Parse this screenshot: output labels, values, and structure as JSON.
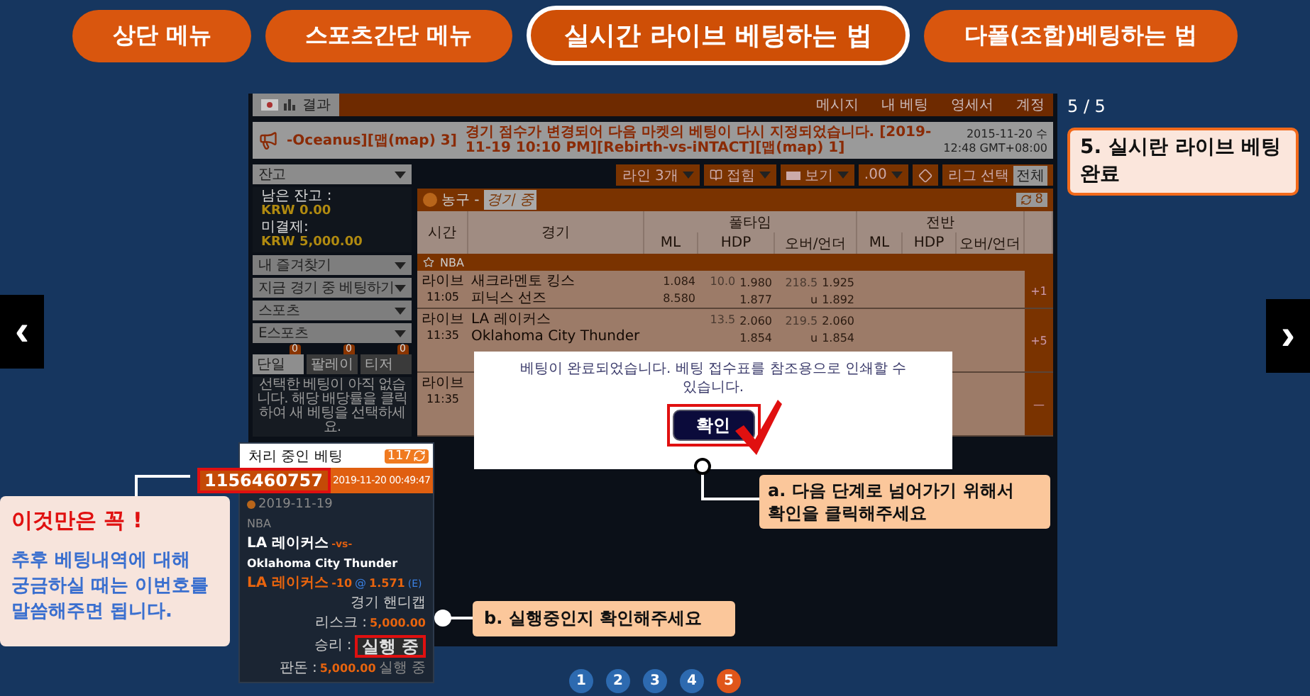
{
  "tabs": [
    {
      "label": "상단 메뉴",
      "selected": false
    },
    {
      "label": "스포츠간단 메뉴",
      "selected": false
    },
    {
      "label": "실시간 라이브 베팅하는 법",
      "selected": true
    },
    {
      "label": "다폴(조합)베팅하는 법",
      "selected": false
    }
  ],
  "nav": {
    "prev": "‹",
    "next": "›"
  },
  "counter": "5 / 5",
  "step_caption": "5. 실시란 라이브 베팅 완료",
  "screenshot": {
    "topbar": {
      "results": "결과",
      "links": [
        "메시지",
        "내 베팅",
        "영세서",
        "계정"
      ]
    },
    "ticker": {
      "event": "-Oceanus][맵(map) 3]",
      "message": "경기 점수가 변경되어 다음 마켓의 베팅이 다시 지정되었습니다. [2019-11-19 10:10 PM][Rebirth-vs-iNTACT][맵(map) 1]",
      "date": "2015-11-20 수",
      "time": "12:48 GMT+08:00"
    },
    "sidebar": {
      "balance_menu": "잔고",
      "balance_label": "남은 잔고 :",
      "balance": "KRW 0.00",
      "pending_label": "미결제:",
      "pending": "KRW 5,000.00",
      "menus": [
        "내 즐겨찾기",
        "지금 경기 중 베팅하기",
        "스포츠",
        "E스포츠"
      ],
      "slip_tabs": [
        {
          "label": "단일",
          "count": "0",
          "selected": true
        },
        {
          "label": "팔레이",
          "count": "0",
          "selected": false
        },
        {
          "label": "티저",
          "count": "0",
          "selected": false
        }
      ],
      "slip_empty": "선택한 베팅이 아직 없습니다. 해당 배당률을 클릭하여 새 베팅을 선택하세요."
    },
    "toolbar": [
      {
        "kind": "select",
        "label": "라인 3개"
      },
      {
        "kind": "book",
        "label": "접힘"
      },
      {
        "kind": "view",
        "label": "보기"
      },
      {
        "kind": "select",
        "label": ".00"
      },
      {
        "kind": "diamond"
      },
      {
        "kind": "league",
        "label": "리그 선택",
        "value": "전체"
      }
    ],
    "section": {
      "sport": "농구 - ",
      "state": "경기 중",
      "count": "8"
    },
    "columns": {
      "time": "시간",
      "match": "경기",
      "full": "풀타임",
      "half": "전반",
      "full_sub": [
        "ML",
        "HDP",
        "오버/언더"
      ],
      "half_sub": [
        "ML",
        "HDP",
        "오버/언더"
      ]
    },
    "league": "NBA",
    "rows": [
      {
        "status": "라이브",
        "time": "11:05",
        "teams": [
          "새크라멘토 킹스",
          "피닉스 선즈"
        ],
        "ml": [
          "1.084",
          "8.580"
        ],
        "hdp_line": "10.0",
        "hdp": [
          "1.980",
          "1.877"
        ],
        "ou_line": "218.5",
        "ou_side": "u",
        "ou": [
          "1.925",
          "1.892"
        ],
        "more": "+1"
      },
      {
        "status": "라이브",
        "time": "11:35",
        "teams": [
          "LA 레이커스",
          "Oklahoma City Thunder"
        ],
        "ml": [],
        "hdp_line": "13.5",
        "hdp": [
          "2.060",
          "1.854"
        ],
        "ou_line": "219.5",
        "ou_side": "u",
        "ou": [
          "2.060",
          "1.854"
        ],
        "more": "+5"
      },
      {
        "status": "라이브",
        "time": "11:35",
        "teams": [],
        "ml": [],
        "hdp": [],
        "ou": [],
        "more": "—"
      }
    ],
    "dialog": {
      "message": "베팅이 완료되었습니다. 베팅 접수표를 참조용으로 인쇄할 수 있습니다.",
      "button": "확인"
    }
  },
  "betslip": {
    "title": "처리 중인 베팅",
    "count": "117",
    "bet_id": "1156460757",
    "placed": "2019-11-20 00:49:47",
    "date": "2019-11-19",
    "league": "NBA",
    "home": "LA 레이커스",
    "vs": "-vs-",
    "away": "Oklahoma City Thunder",
    "pick": "LA 레이커스",
    "line": "-10",
    "at": "@",
    "odds": "1.571",
    "odds_type": "(E)",
    "market": "경기 핸디캡",
    "risk_label": "리스크 : ",
    "risk": "5,000.00",
    "win_label": "승리 : ",
    "status": "실행 중",
    "stake_label": "판돈 : ",
    "stake": "5,000.00",
    "stake_status": "실행 중"
  },
  "callouts": {
    "important_title": "이것만은 꼭 !",
    "important_body": "추후 베팅내역에 대해 궁금하실 때는 이번호를 말씀해주면 됩니다.",
    "a": "a. 다음 단계로 넘어가기 위해서 확인을 클릭해주세요",
    "b": "b. 실행중인지 확인해주세요"
  },
  "pages": [
    {
      "label": "1",
      "selected": false
    },
    {
      "label": "2",
      "selected": false
    },
    {
      "label": "3",
      "selected": false
    },
    {
      "label": "4",
      "selected": false
    },
    {
      "label": "5",
      "selected": true
    }
  ]
}
